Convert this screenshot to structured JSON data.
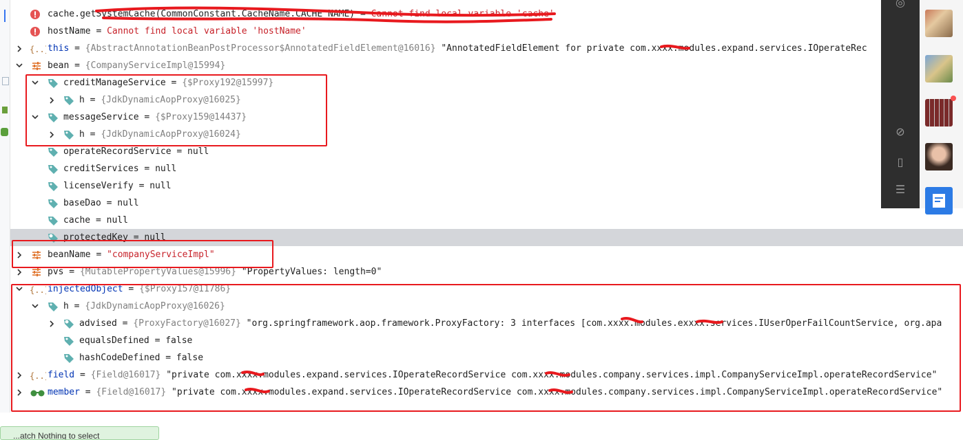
{
  "variables": {
    "rows": [
      {
        "name": "cache.getSystemCache(CommonConstant.CacheName.CACHE_NAME)",
        "op": " = ",
        "ref": "",
        "value": "Cannot find local variable 'cache'",
        "kind": "error"
      },
      {
        "name": "hostName",
        "op": " = ",
        "ref": "",
        "value": "Cannot find local variable 'hostName'",
        "kind": "error"
      },
      {
        "name": "this",
        "op": " = ",
        "ref": "{AbstractAnnotationBeanPostProcessor$AnnotatedFieldElement@16016}",
        "value": "\"AnnotatedFieldElement for private com.xxxx.modules.expand.services.IOperateRec",
        "kind": "object"
      },
      {
        "name": "bean",
        "op": " = ",
        "ref": "{CompanyServiceImpl@15994}",
        "value": "",
        "kind": "object"
      },
      {
        "name": "creditManageService",
        "op": " = ",
        "ref": "{$Proxy192@15997}",
        "value": "",
        "kind": "field"
      },
      {
        "name": "h",
        "op": " = ",
        "ref": "{JdkDynamicAopProxy@16025}",
        "value": "",
        "kind": "field"
      },
      {
        "name": "messageService",
        "op": " = ",
        "ref": "{$Proxy159@14437}",
        "value": "",
        "kind": "field"
      },
      {
        "name": "h",
        "op": " = ",
        "ref": "{JdkDynamicAopProxy@16024}",
        "value": "",
        "kind": "field"
      },
      {
        "name": "operateRecordService",
        "op": " = ",
        "ref": "",
        "value": "null",
        "kind": "field"
      },
      {
        "name": "creditServices",
        "op": " = ",
        "ref": "",
        "value": "null",
        "kind": "field"
      },
      {
        "name": "licenseVerify",
        "op": " = ",
        "ref": "",
        "value": "null",
        "kind": "field"
      },
      {
        "name": "baseDao",
        "op": " = ",
        "ref": "",
        "value": "null",
        "kind": "field"
      },
      {
        "name": "cache",
        "op": " = ",
        "ref": "",
        "value": "null",
        "kind": "field"
      },
      {
        "name": "protectedKey",
        "op": " = ",
        "ref": "",
        "value": "null",
        "kind": "static"
      },
      {
        "name": "beanName",
        "op": " = ",
        "ref": "",
        "value": "\"companyServiceImpl\"",
        "kind": "string"
      },
      {
        "name": "pvs",
        "op": " = ",
        "ref": "{MutablePropertyValues@15996}",
        "value": "\"PropertyValues: length=0\"",
        "kind": "object"
      },
      {
        "name": "injectedObject",
        "op": " = ",
        "ref": "{$Proxy157@11786}",
        "value": "",
        "kind": "object"
      },
      {
        "name": "h",
        "op": " = ",
        "ref": "{JdkDynamicAopProxy@16026}",
        "value": "",
        "kind": "field"
      },
      {
        "name": "advised",
        "op": " = ",
        "ref": "{ProxyFactory@16027}",
        "value": "\"org.springframework.aop.framework.ProxyFactory: 3 interfaces [com.xxxx.modules.exxxx.services.IUserOperFailCountService, org.apa",
        "kind": "static"
      },
      {
        "name": "equalsDefined",
        "op": " = ",
        "ref": "",
        "value": "false",
        "kind": "field"
      },
      {
        "name": "hashCodeDefined",
        "op": " = ",
        "ref": "",
        "value": "false",
        "kind": "field"
      },
      {
        "name": "field",
        "op": " = ",
        "ref": "{Field@16017}",
        "value": "\"private com.xxxx.modules.expand.services.IOperateRecordService com.xxxx.modules.company.services.impl.CompanyServiceImpl.operateRecordService\"",
        "kind": "object"
      },
      {
        "name": "member",
        "op": " = ",
        "ref": "{Field@16017}",
        "value": "\"private com.xxxx.modules.expand.services.IOperateRecordService com.xxxx.modules.company.services.impl.CompanyServiceImpl.operateRecordService\"",
        "kind": "watch"
      }
    ]
  },
  "status_toast": "...atch  Nothing to select",
  "colors": {
    "highlight_box": "#e8191e",
    "string": "#067d17",
    "error": "#c7222a",
    "reference": "#808080",
    "field_tag": "#4aa3a3"
  },
  "icons": {
    "error": "error-icon",
    "object": "object-brace-icon",
    "field": "field-tag-icon",
    "static": "static-field-icon",
    "bean": "bean-settings-icon",
    "watch": "glasses-icon"
  }
}
